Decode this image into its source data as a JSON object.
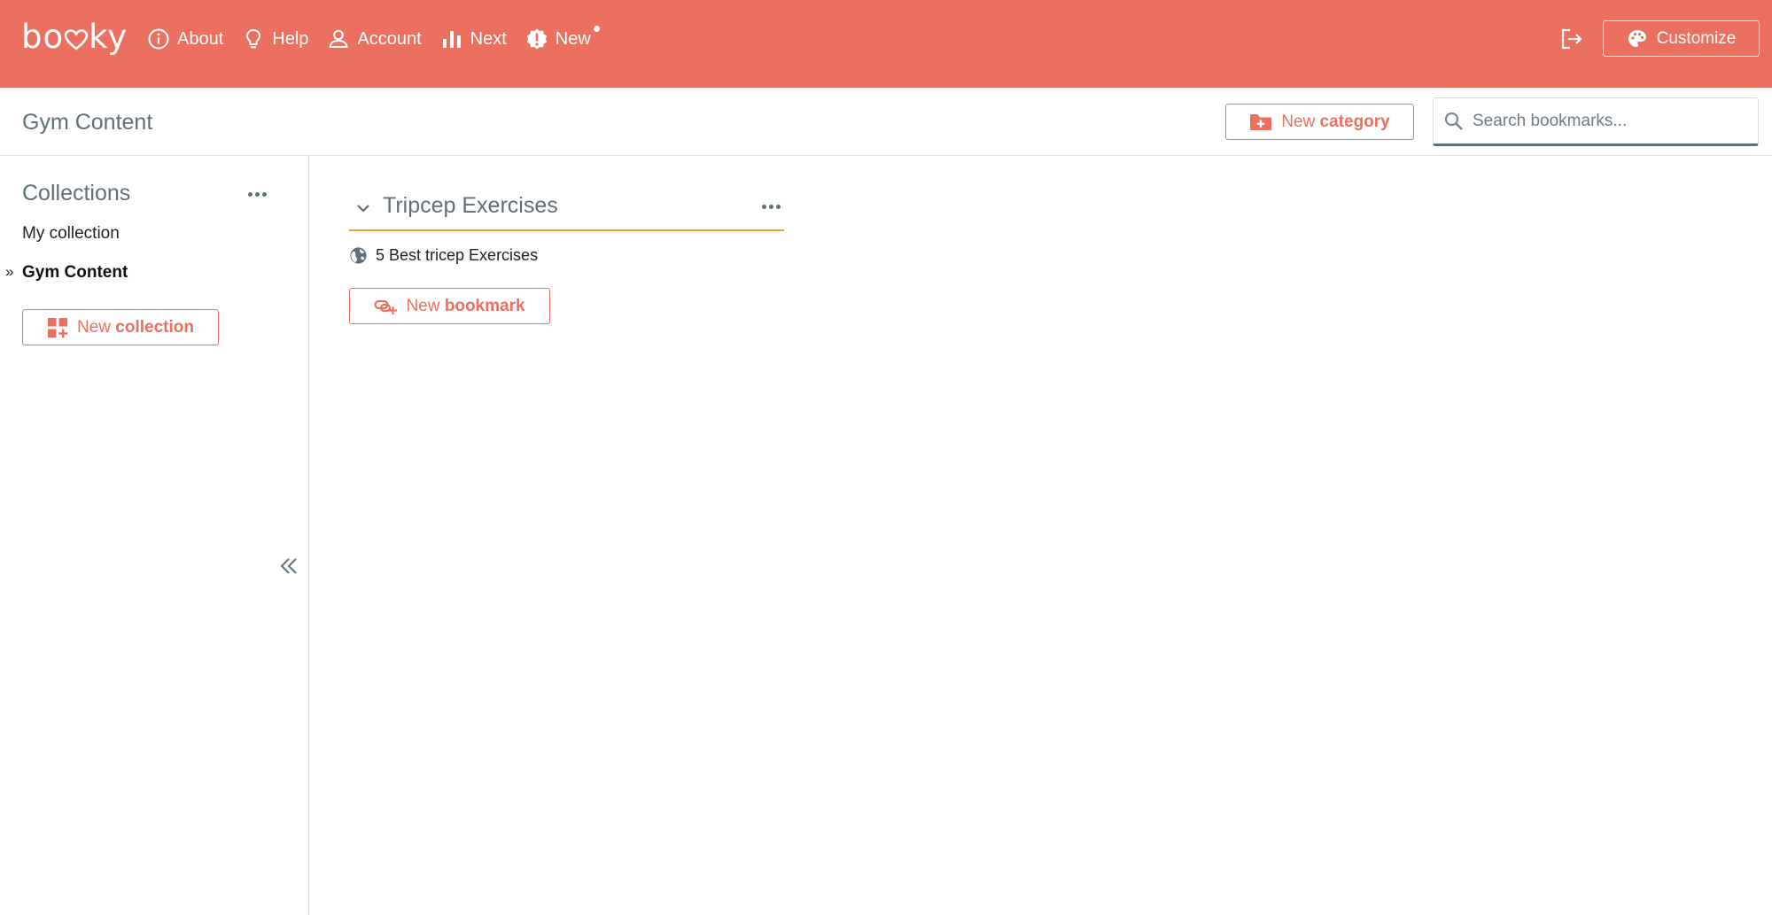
{
  "app": {
    "logo": "booky"
  },
  "nav": {
    "items": [
      {
        "label": "About",
        "icon": "info-icon"
      },
      {
        "label": "Help",
        "icon": "lightbulb-icon"
      },
      {
        "label": "Account",
        "icon": "user-icon"
      },
      {
        "label": "Next",
        "icon": "bar-chart-icon"
      },
      {
        "label": "New",
        "icon": "alert-badge-icon"
      }
    ],
    "customize_label": "Customize"
  },
  "header": {
    "title": "Gym Content",
    "new_category_prefix": "New",
    "new_category_bold": "category",
    "search_placeholder": "Search bookmarks..."
  },
  "sidebar": {
    "heading": "Collections",
    "items": [
      {
        "label": "My collection",
        "active": false
      },
      {
        "label": "Gym Content",
        "active": true
      }
    ],
    "active_marker": "»",
    "new_collection_prefix": "New",
    "new_collection_bold": "collection"
  },
  "main": {
    "category": {
      "title": "Tripcep Exercises",
      "bookmarks": [
        {
          "label": "5 Best tricep Exercises"
        }
      ]
    },
    "new_bookmark_prefix": "New",
    "new_bookmark_bold": "bookmark"
  },
  "colors": {
    "brand": "#ec7060",
    "text": "#5f6f7a",
    "category_underline": "#dcaa3c"
  }
}
